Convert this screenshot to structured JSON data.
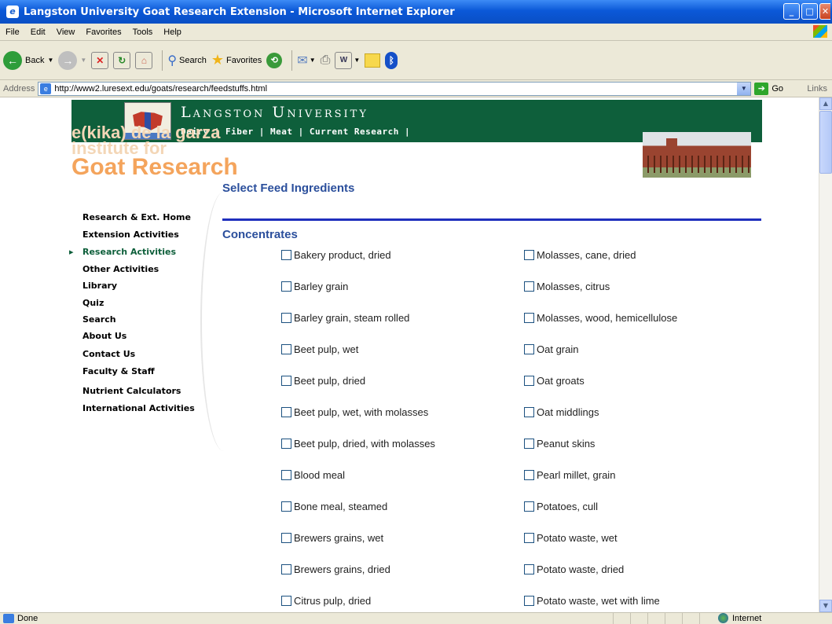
{
  "window": {
    "title": "Langston University Goat Research Extension - Microsoft Internet Explorer"
  },
  "menu": [
    "File",
    "Edit",
    "View",
    "Favorites",
    "Tools",
    "Help"
  ],
  "toolbar": {
    "back": "Back",
    "search": "Search",
    "favorites": "Favorites"
  },
  "address": {
    "label": "Address",
    "url": "http://www2.luresext.edu/goats/research/feedstuffs.html",
    "go": "Go",
    "links": "Links"
  },
  "status": {
    "text": "Done",
    "zone": "Internet"
  },
  "page": {
    "university": "Langston University",
    "topnav": [
      "Dairy",
      "Fiber",
      "Meat",
      "Current Research"
    ],
    "faint_line1": "e(kika) de la garza",
    "faint_line2": "institute for",
    "goat_research": "Goat Research",
    "title": "Select Feed Ingredients",
    "sidebar": [
      "Research & Ext. Home",
      "Extension Activities",
      "Research Activities",
      "Other Activities",
      "Library",
      "Quiz",
      "Search",
      "About Us",
      "Contact Us",
      "Faculty & Staff",
      "Nutrient Calculators",
      "International Activities"
    ],
    "section": "Concentrates",
    "left_items": [
      "Bakery product, dried",
      "Barley grain",
      "Barley grain, steam rolled",
      "Beet pulp, wet",
      "Beet pulp, dried",
      "Beet pulp, wet, with molasses",
      "Beet pulp, dried, with molasses",
      "Blood meal",
      "Bone meal, steamed",
      "Brewers grains, wet",
      "Brewers grains, dried",
      "Citrus pulp, dried"
    ],
    "right_items": [
      "Molasses, cane, dried",
      "Molasses, citrus",
      "Molasses, wood, hemicellulose",
      "Oat grain",
      "Oat groats",
      "Oat middlings",
      "Peanut skins",
      "Pearl millet, grain",
      "Potatoes, cull",
      "Potato waste, wet",
      "Potato waste, dried",
      "Potato waste, wet with lime"
    ]
  }
}
